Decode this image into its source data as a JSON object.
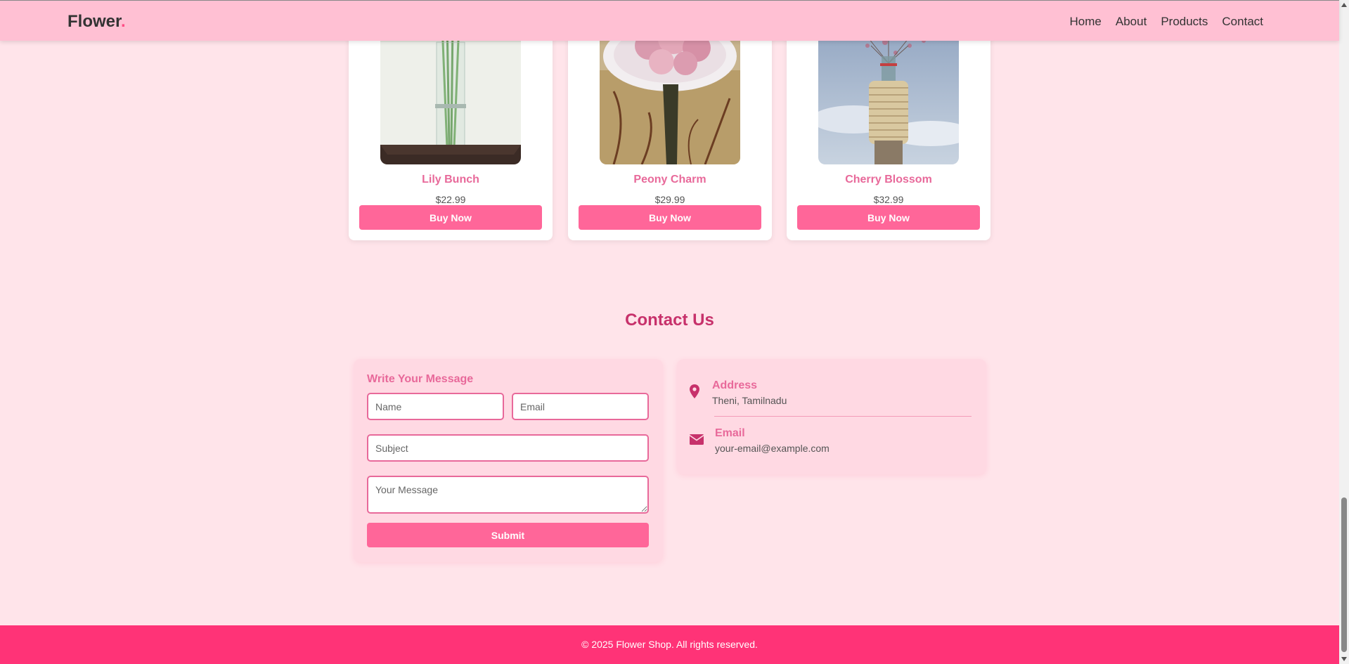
{
  "brand": {
    "name": "Flower",
    "dot": "."
  },
  "nav": [
    "Home",
    "About",
    "Products",
    "Contact"
  ],
  "products": [
    {
      "name": "Lily Bunch",
      "price": "$22.99",
      "button": "Buy Now"
    },
    {
      "name": "Peony Charm",
      "price": "$29.99",
      "button": "Buy Now"
    },
    {
      "name": "Cherry Blossom",
      "price": "$32.99",
      "button": "Buy Now"
    }
  ],
  "contact": {
    "title": "Contact Us",
    "form": {
      "heading": "Write Your Message",
      "name_placeholder": "Name",
      "email_placeholder": "Email",
      "subject_placeholder": "Subject",
      "message_placeholder": "Your Message",
      "submit": "Submit"
    },
    "info": {
      "address_label": "Address",
      "address_value": "Theni, Tamilnadu",
      "email_label": "Email",
      "email_value": "your-email@example.com"
    }
  },
  "footer": {
    "text": "© 2025 Flower Shop. All rights reserved."
  },
  "colors": {
    "accent": "#ff6699",
    "accent_text": "#e8699a",
    "title": "#c7316b",
    "footer": "#ff3377",
    "navbar": "#ffc0d3",
    "page_bg": "#ffe4ea"
  },
  "icons": [
    "map-pin-icon",
    "envelope-icon"
  ]
}
